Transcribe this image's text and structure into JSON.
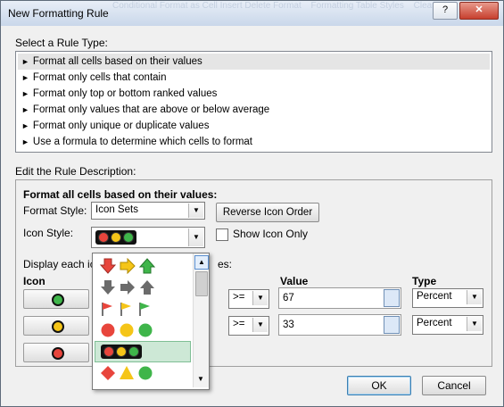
{
  "window": {
    "title": "New Formatting Rule",
    "help_label": "?",
    "close_label": "✕",
    "background_ribbon": [
      "Conditional Format as Cell Insert Delete Format",
      "Formatting Table Styles",
      "Clear"
    ]
  },
  "rule_type": {
    "heading": "Select a Rule Type:",
    "items": [
      "Format all cells based on their values",
      "Format only cells that contain",
      "Format only top or bottom ranked values",
      "Format only values that are above or below average",
      "Format only unique or duplicate values",
      "Use a formula to determine which cells to format"
    ],
    "selected_index": 0
  },
  "description": {
    "heading": "Edit the Rule Description:",
    "subheading": "Format all cells based on their values:",
    "format_style_label": "Format Style:",
    "format_style_value": "Icon Sets",
    "reverse_icon_order_label": "Reverse Icon Order",
    "icon_style_label": "Icon Style:",
    "show_icon_only_label": "Show Icon Only",
    "display_each_prefix": "Display each ic",
    "display_each_suffix": "es:",
    "columns": {
      "icon": "Icon",
      "value": "Value",
      "type": "Type"
    },
    "rows": [
      {
        "icon": "green-circle",
        "operator": ">=",
        "value": "67",
        "type": "Percent"
      },
      {
        "icon": "yellow-circle",
        "operator": ">=",
        "value": "33",
        "type": "Percent"
      },
      {
        "icon": "red-circle"
      }
    ]
  },
  "icon_style_dropdown": {
    "options": [
      "arrows-colored",
      "arrows-gray",
      "flags",
      "traffic-lights-unrimmed",
      "traffic-lights-rimmed",
      "signs"
    ],
    "selected_index": 4
  },
  "footer": {
    "ok_label": "OK",
    "cancel_label": "Cancel"
  },
  "colors": {
    "red": "#e8453c",
    "yellow": "#f5c518",
    "green": "#3fb54a",
    "gray": "#6b6b6b"
  }
}
